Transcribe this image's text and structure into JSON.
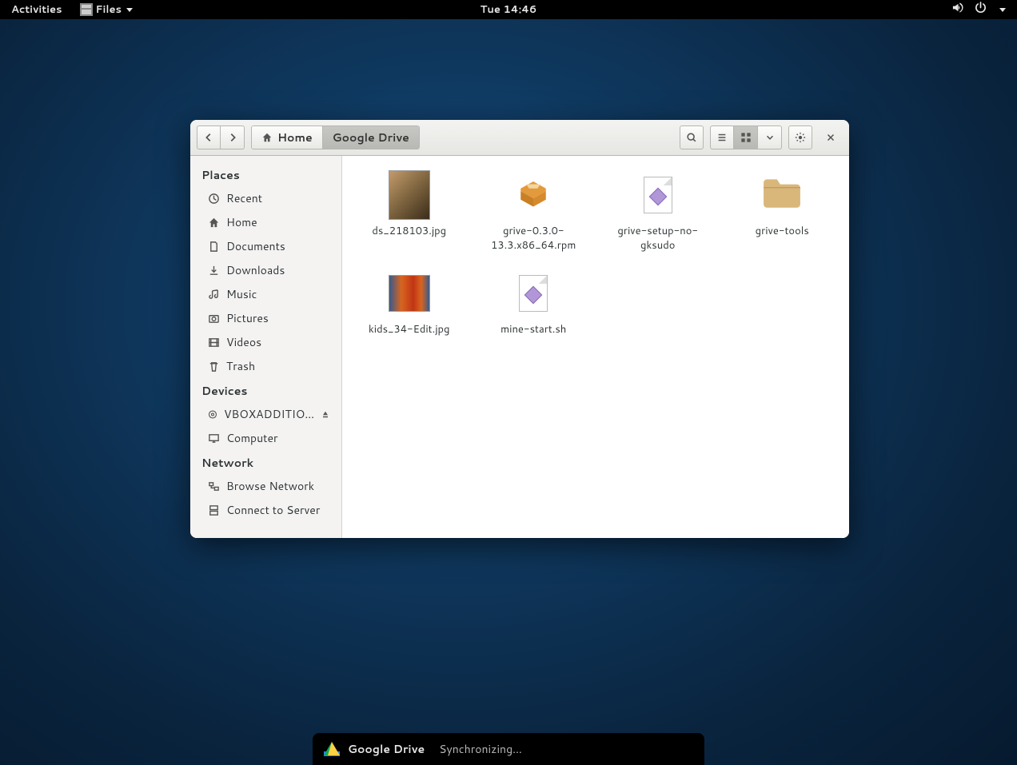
{
  "topbar": {
    "activities": "Activities",
    "app_name": "Files",
    "clock": "Tue 14:46"
  },
  "toolbar": {
    "path_home": "Home",
    "path_current": "Google Drive"
  },
  "sidebar": {
    "places_label": "Places",
    "places": [
      {
        "label": "Recent"
      },
      {
        "label": "Home"
      },
      {
        "label": "Documents"
      },
      {
        "label": "Downloads"
      },
      {
        "label": "Music"
      },
      {
        "label": "Pictures"
      },
      {
        "label": "Videos"
      },
      {
        "label": "Trash"
      }
    ],
    "devices_label": "Devices",
    "devices": [
      {
        "label": "VBOXADDITIO...",
        "ejectable": true
      },
      {
        "label": "Computer"
      }
    ],
    "network_label": "Network",
    "network": [
      {
        "label": "Browse Network"
      },
      {
        "label": "Connect to Server"
      }
    ]
  },
  "files": [
    {
      "name": "ds_218103.jpg",
      "kind": "image1"
    },
    {
      "name": "grive-0.3.0-13.3.x86_64.rpm",
      "kind": "package"
    },
    {
      "name": "grive-setup-no-gksudo",
      "kind": "script"
    },
    {
      "name": "grive-tools",
      "kind": "folder"
    },
    {
      "name": "kids_34-Edit.jpg",
      "kind": "image2"
    },
    {
      "name": "mine-start.sh",
      "kind": "script"
    }
  ],
  "notification": {
    "title": "Google Drive",
    "message": "Synchronizing..."
  }
}
